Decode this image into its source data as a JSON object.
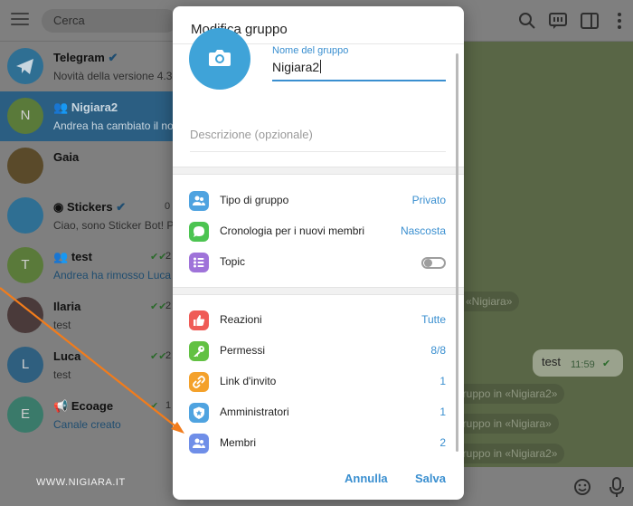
{
  "background": {
    "search_placeholder": "Cerca",
    "chats": [
      {
        "initial": "",
        "title": "Telegram",
        "subtitle": "Novità della versione 4.3.",
        "avatar_color": "#2f6f93"
      },
      {
        "initial": "N",
        "title": "Nigiara2",
        "subtitle": "Andrea ha cambiato il no",
        "avatar_color": "#5a7a3a"
      },
      {
        "initial": "",
        "title": "Gaia",
        "subtitle": "",
        "avatar_color": "#5a4a2a"
      },
      {
        "initial": "",
        "title": "Stickers",
        "subtitle": "Ciao, sono Sticker Bot! Po",
        "time": "0",
        "avatar_color": "#2f6f93"
      },
      {
        "initial": "T",
        "title": "test",
        "subtitle": "Andrea ha rimosso Luca",
        "time": "2",
        "avatar_color": "#5a7a3a"
      },
      {
        "initial": "",
        "title": "Ilaria",
        "subtitle": "test",
        "time": "2",
        "avatar_color": "#4a3a3a"
      },
      {
        "initial": "L",
        "title": "Luca",
        "subtitle": "test",
        "time": "2",
        "avatar_color": "#2f5f7f"
      },
      {
        "initial": "E",
        "title": "Ecoage",
        "subtitle": "Canale creato",
        "time": "1",
        "avatar_color": "#3a7a6a"
      }
    ],
    "chat_bubbles": [
      "o «Nigiara»",
      "gruppo in «Nigiara2»",
      "gruppo in «Nigiara»",
      "gruppo in «Nigiara2»"
    ],
    "message": {
      "text": "test",
      "time": "11:59"
    },
    "watermark": "WWW.NIGIARA.IT"
  },
  "modal": {
    "title": "Modifica gruppo",
    "group_name": {
      "label": "Nome del gruppo",
      "value": "Nigiara2"
    },
    "description_placeholder": "Descrizione (opzionale)",
    "settings": [
      {
        "label": "Tipo di gruppo",
        "value": "Privato",
        "icon": "group-type-icon",
        "color": "#4fa3e0"
      },
      {
        "label": "Cronologia per i nuovi membri",
        "value": "Nascosta",
        "icon": "history-icon",
        "color": "#4cc451"
      },
      {
        "label": "Topic",
        "value": "",
        "icon": "topic-icon",
        "color": "#9f73d9",
        "toggle_on": false
      }
    ],
    "permissions": [
      {
        "label": "Reazioni",
        "value": "Tutte",
        "icon": "reactions-icon",
        "color": "#ef5b56"
      },
      {
        "label": "Permessi",
        "value": "8/8",
        "icon": "permissions-key-icon",
        "color": "#62c143"
      },
      {
        "label": "Link d'invito",
        "value": "1",
        "icon": "invite-link-icon",
        "color": "#f4a12b"
      },
      {
        "label": "Amministratori",
        "value": "1",
        "icon": "admins-icon",
        "color": "#4fa3e0"
      },
      {
        "label": "Membri",
        "value": "2",
        "icon": "members-icon",
        "color": "#6f8ee8"
      }
    ],
    "buttons": {
      "cancel": "Annulla",
      "save": "Salva"
    }
  }
}
